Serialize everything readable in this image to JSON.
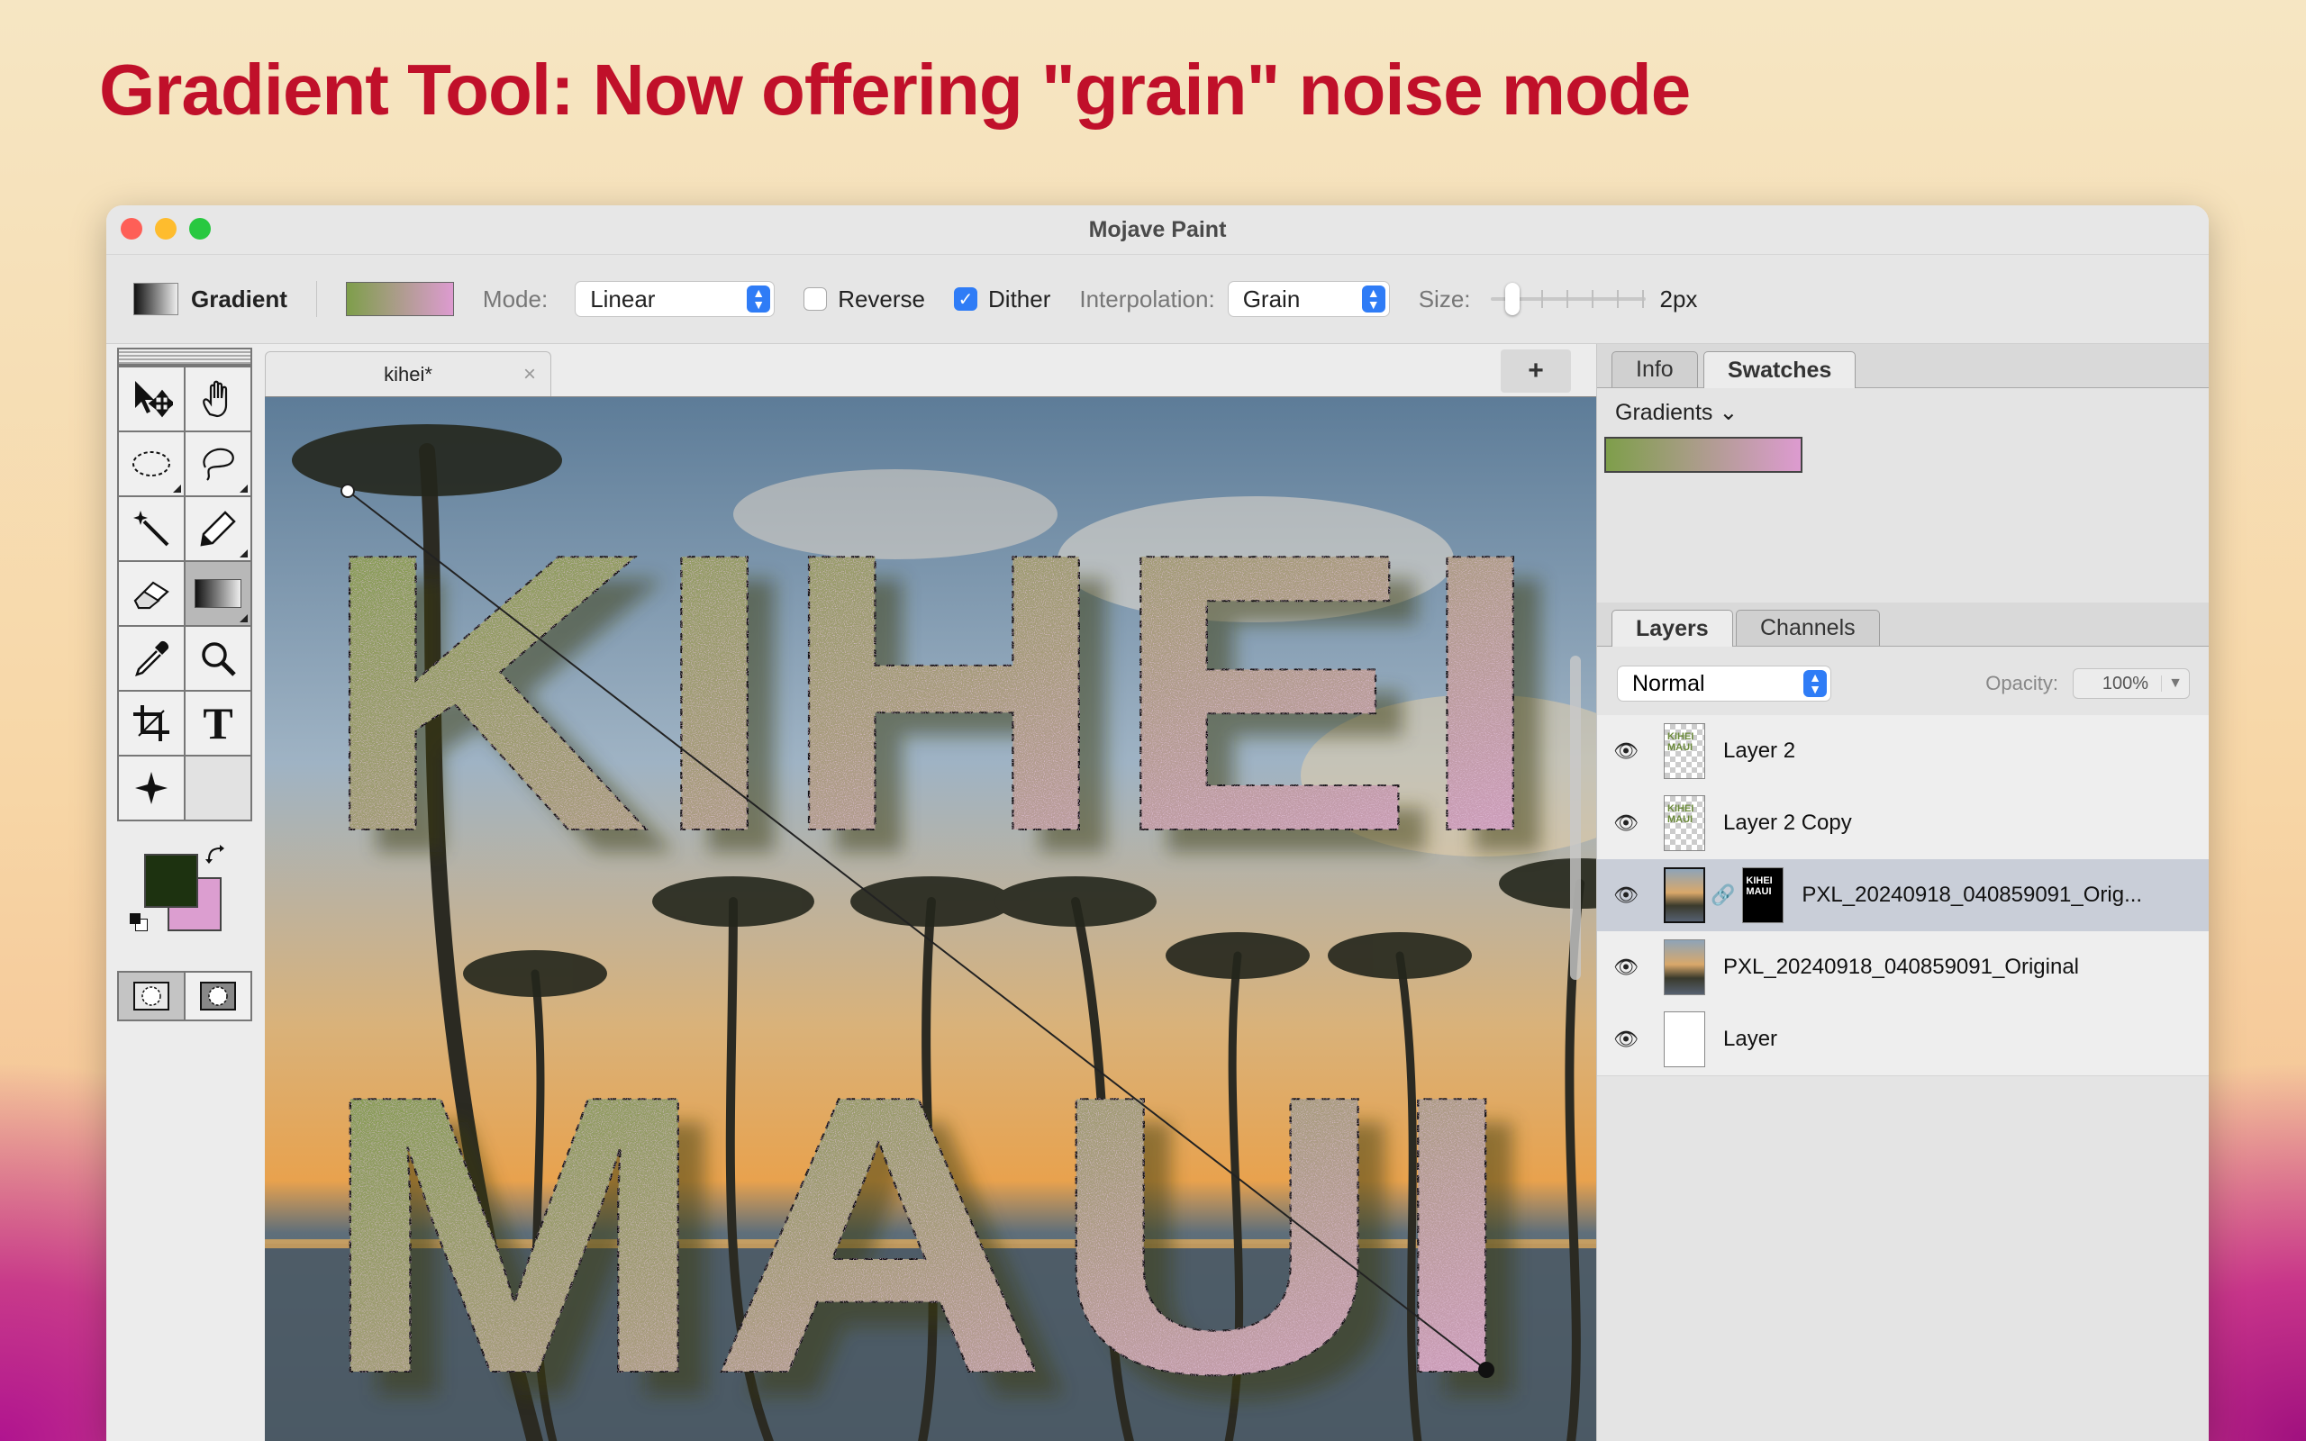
{
  "headline": "Gradient Tool: Now offering \"grain\" noise mode",
  "window": {
    "title": "Mojave Paint"
  },
  "toolbar": {
    "tool_name": "Gradient",
    "mode_label": "Mode:",
    "mode_value": "Linear",
    "reverse_label": "Reverse",
    "reverse_checked": false,
    "dither_label": "Dither",
    "dither_checked": true,
    "interpolation_label": "Interpolation:",
    "interpolation_value": "Grain",
    "size_label": "Size:",
    "size_value": "2px"
  },
  "document": {
    "tab_label": "kihei",
    "modified_mark": "*",
    "close_glyph": "×",
    "new_tab_label": "+"
  },
  "canvas": {
    "text_line1": "KIHEI",
    "text_line2": "MAUI"
  },
  "colors": {
    "foreground": "#1d3210",
    "background": "#dc9ed0",
    "gradient_start": "#7e9e4a",
    "gradient_end": "#dd9bd0"
  },
  "info_panel": {
    "tabs": [
      "Info",
      "Swatches"
    ],
    "active_tab": "Swatches",
    "gradients_label": "Gradients",
    "gradients_chevron": "⌄"
  },
  "layers_panel": {
    "tabs": [
      "Layers",
      "Channels"
    ],
    "active_tab": "Layers",
    "blend_mode": "Normal",
    "opacity_label": "Opacity:",
    "opacity_value": "100%",
    "layers": [
      {
        "name": "Layer 2",
        "thumb_text": "KIHEI MAUI",
        "selected": false
      },
      {
        "name": "Layer 2 Copy",
        "thumb_text": "KIHEI MAUI",
        "selected": false
      },
      {
        "name": "PXL_20240918_040859091_Orig...",
        "mask_text": "KIHEI MAUI",
        "selected": true
      },
      {
        "name": "PXL_20240918_040859091_Original",
        "selected": false
      },
      {
        "name": "Layer",
        "selected": false
      }
    ]
  },
  "tools": [
    "move-tool",
    "hand-tool",
    "marquee-tool",
    "lasso-tool",
    "magic-wand-tool",
    "pencil-tool",
    "eraser-tool",
    "gradient-tool",
    "eyedropper-tool",
    "zoom-tool",
    "crop-tool",
    "text-tool",
    "sparkle-tool"
  ],
  "text_tool_glyph": "T"
}
